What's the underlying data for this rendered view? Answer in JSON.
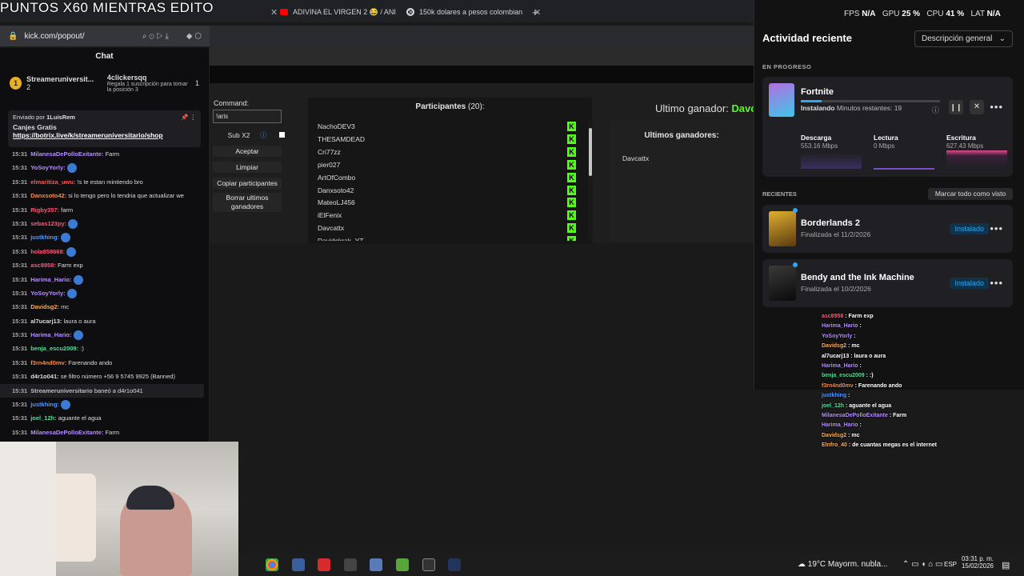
{
  "overlay_title": "PUNTOS X60 MIENTRAS EDITO",
  "tabs": [
    {
      "label": "ADIVINA EL VIRGEN 2 😂 / ANI"
    },
    {
      "label": "150k dolares a pesos colombian"
    }
  ],
  "address": "kick.com/popout/",
  "chat": {
    "title": "Chat",
    "leader1": {
      "name": "Streameruniversit...",
      "count": "2",
      "rank": "1"
    },
    "leader2": {
      "name": "4clickersqq",
      "count": "1",
      "note": "Regala 1 suscripción para tomar la posición 3"
    },
    "pinned": {
      "by": "Enviado por",
      "user": "1LuisRem",
      "title": "Canjes Gratis",
      "link": "https://botrix.live/k/streameruniversitario/shop"
    },
    "messages": [
      {
        "time": "15:31",
        "user": "MilanesaDePolloExitante:",
        "text": "Farm",
        "color": "#b38cff"
      },
      {
        "time": "15:31",
        "user": "YoSoyYorly:",
        "text": "",
        "color": "#b38cff"
      },
      {
        "time": "15:31",
        "user": "elmaritiza_uwu:",
        "text": "!s te estan mintiendo bro",
        "color": "#ff5555"
      },
      {
        "time": "15:31",
        "user": "Danxsoto42:",
        "text": "si lo tengo pero lo tendria que actualizar we",
        "color": "#ff8844"
      },
      {
        "time": "15:31",
        "user": "Rigby357:",
        "text": "farm",
        "color": "#ff5577"
      },
      {
        "time": "15:31",
        "user": "sebas123py:",
        "text": "",
        "color": "#ff5577"
      },
      {
        "time": "15:31",
        "user": "justkhing:",
        "text": "",
        "color": "#5599ff"
      },
      {
        "time": "15:31",
        "user": "hola858668:",
        "text": "",
        "color": "#ff5577"
      },
      {
        "time": "15:31",
        "user": "asc8958:",
        "text": "Farm exp",
        "color": "#ff5577"
      },
      {
        "time": "15:31",
        "user": "Harima_Hario:",
        "text": "",
        "color": "#b38cff"
      },
      {
        "time": "15:31",
        "user": "YoSoyYorly:",
        "text": "",
        "color": "#b38cff"
      },
      {
        "time": "15:31",
        "user": "Davidsg2:",
        "text": "mc",
        "color": "#ffaa55"
      },
      {
        "time": "15:31",
        "user": "al7ucarj13:",
        "text": "laura o aura",
        "color": "#dddddd"
      },
      {
        "time": "15:31",
        "user": "Harima_Hario:",
        "text": "",
        "color": "#b38cff"
      },
      {
        "time": "15:31",
        "user": "benja_escu2009:",
        "text": ":)",
        "color": "#55dd99"
      },
      {
        "time": "15:31",
        "user": "f3rn4nd0mv:",
        "text": "Farenando ando",
        "color": "#ff8844"
      },
      {
        "time": "15:31",
        "user": "d4r1o041:",
        "text": "se filtro número +56 9 5745 9925 (Banned)",
        "color": "#dddddd"
      },
      {
        "time": "15:31",
        "user": "Streameruniversitario",
        "text": "baneó a d4r1o041",
        "color": "#bbbbbb"
      },
      {
        "time": "15:31",
        "user": "justkhing:",
        "text": "",
        "color": "#5599ff"
      },
      {
        "time": "15:31",
        "user": "joel_12h:",
        "text": "aguante el agua",
        "color": "#55dd99"
      },
      {
        "time": "15:31",
        "user": "MilanesaDePolloExitante:",
        "text": "Farm",
        "color": "#b38cff"
      }
    ]
  },
  "tool": {
    "command_label": "Command:",
    "command_value": "!aris",
    "sub_label": "Sub X2",
    "buttons": [
      "Aceptar",
      "Limpiar",
      "Copiar participantes",
      "Borrar ultimos ganadores"
    ],
    "participants_title": "Participantes",
    "participants_count": "(20):",
    "participants": [
      "NachoDEV3",
      "THESAMDEAD",
      "Cri77zz",
      "pier027",
      "ArtOfCombo",
      "Danxsoto42",
      "MateoLJ456",
      "iElFenix",
      "Davcattx",
      "Davidckrak_YT"
    ],
    "last_winner_label": "Ultimo ganador:",
    "last_winner": "Davc",
    "winners_title": "Ultimos ganadores:",
    "winners": [
      "Davcattx"
    ]
  },
  "epic": {
    "stats": {
      "fps_label": "FPS",
      "fps": "N/A",
      "gpu_label": "GPU",
      "gpu": "25 %",
      "cpu_label": "CPU",
      "cpu": "41 %",
      "lat_label": "LAT",
      "lat": "N/A"
    },
    "title": "Actividad reciente",
    "dropdown": "Descripción general",
    "in_progress": "EN PROGRESO",
    "game": "Fortnite",
    "status": "Instalando",
    "remaining": "Minutos restantes: 19",
    "progress": 0.15,
    "download_label": "Descarga",
    "download": "553.16 Mbps",
    "read_label": "Lectura",
    "read": "0 Mbps",
    "write_label": "Escritura",
    "write": "627.43 Mbps",
    "recent": "RECIENTES",
    "mark_all": "Marcar todo como visto",
    "recent_items": [
      {
        "name": "Borderlands 2",
        "date": "Finalizada el 11/2/2026",
        "badge": "Instalado"
      },
      {
        "name": "Bendy and the Ink Machine",
        "date": "Finalizada el 10/2/2026",
        "badge": "Instalado"
      }
    ]
  },
  "overlay_chat": [
    {
      "user": "asc8958",
      "text": ": Farm exp",
      "color": "#ff5577"
    },
    {
      "user": "Harima_Hario",
      "text": ":",
      "color": "#b38cff"
    },
    {
      "user": "YoSoyYorly",
      "text": ":",
      "color": "#b38cff"
    },
    {
      "user": "Davidsg2",
      "text": ": mc",
      "color": "#ffaa55"
    },
    {
      "user": "al7ucarj13",
      "text": ": laura o aura",
      "color": "#ffffff"
    },
    {
      "user": "Harima_Hario",
      "text": ":",
      "color": "#b38cff"
    },
    {
      "user": "benja_escu2009",
      "text": ": :)",
      "color": "#55dd99"
    },
    {
      "user": "f3rn4nd0mv",
      "text": ": Farenando ando",
      "color": "#ff8844"
    },
    {
      "user": "justkhing",
      "text": ":",
      "color": "#5599ff"
    },
    {
      "user": "joel_12h",
      "text": ": aguante el agua",
      "color": "#55dd99"
    },
    {
      "user": "MilanesaDePolloExitante",
      "text": ": Farm",
      "color": "#b38cff"
    },
    {
      "user": "Harima_Hario",
      "text": ":",
      "color": "#b38cff"
    },
    {
      "user": "Davidsg2",
      "text": ": mc",
      "color": "#ffaa55"
    },
    {
      "user": "Elnfro_40",
      "text": ": de cuantas megas es el internet",
      "color": "#ffaa55"
    }
  ],
  "taskbar": {
    "weather": "19°C",
    "weather_text": "Mayorm. nubla...",
    "lang": "ESP",
    "time": "03:31 p. m.",
    "date": "15/02/2026"
  }
}
